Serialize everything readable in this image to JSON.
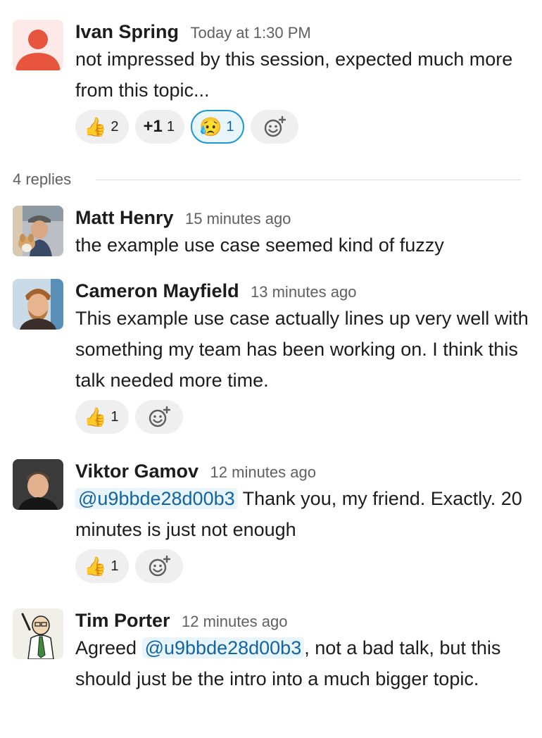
{
  "parent": {
    "author": "Ivan Spring",
    "time": "Today at 1:30 PM",
    "text": "not impressed by this session, expected much more from this topic...",
    "reactions": [
      {
        "emoji": "👍",
        "count": "2"
      },
      {
        "emoji": "+1",
        "count": "1"
      },
      {
        "emoji": "😥",
        "count": "1"
      }
    ]
  },
  "replies_label": "4 replies",
  "replies": [
    {
      "author": "Matt Henry",
      "time": "15 minutes ago",
      "text": "the example use case seemed kind of fuzzy"
    },
    {
      "author": "Cameron Mayfield",
      "time": "13 minutes ago",
      "text": "This example use case actually lines up very well with something my team has been working on. I think this talk needed more time.",
      "reactions": [
        {
          "emoji": "👍",
          "count": "1"
        }
      ]
    },
    {
      "author": "Viktor Gamov",
      "time": "12 minutes ago",
      "mention": "@u9bbde28d00b3",
      "text": "Thank you, my friend. Exactly. 20 minutes is just not enough",
      "reactions": [
        {
          "emoji": "👍",
          "count": "1"
        }
      ]
    },
    {
      "author": "Tim Porter",
      "time": "12 minutes ago",
      "text_before": "Agreed",
      "mention": "@u9bbde28d00b3",
      "text_after": ", not a bad talk, but this should just be the intro into a much bigger topic."
    }
  ],
  "colors": {
    "mention_bg": "#e8f5fa",
    "mention_text": "#1264a3",
    "active_reaction_border": "#1d9bd1"
  }
}
